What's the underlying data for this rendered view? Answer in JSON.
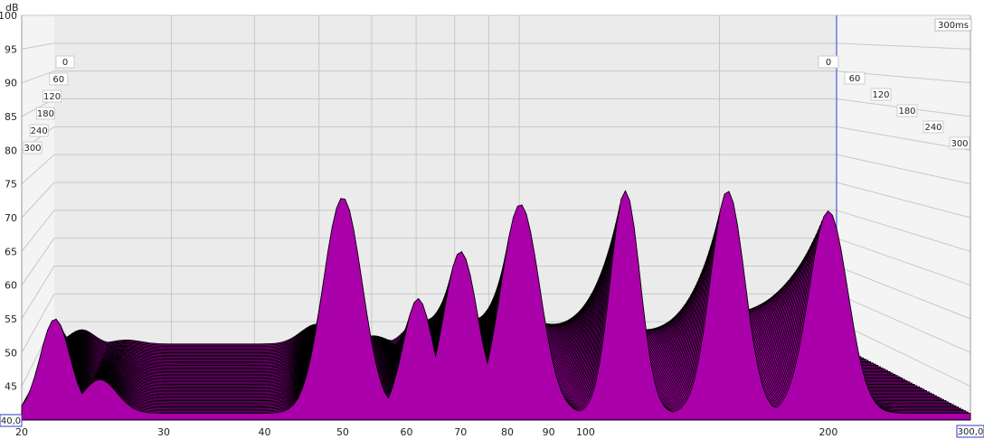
{
  "chart_data": {
    "type": "waterfall",
    "y_unit": "dB",
    "ylim": [
      40,
      100
    ],
    "y_ticks": [
      45,
      50,
      55,
      60,
      65,
      70,
      75,
      80,
      85,
      90,
      95,
      100
    ],
    "xlim": [
      20,
      300
    ],
    "x_scale": "log",
    "x_ticks": [
      20,
      30,
      40,
      50,
      60,
      70,
      80,
      90,
      100,
      200
    ],
    "x_min_label": "20",
    "x_max_label": "300,0",
    "y_min_label": "40,0",
    "z_ticks": [
      "0",
      "60",
      "120",
      "180",
      "240",
      "300"
    ],
    "z_max_label": "300ms",
    "z_range_ms": [
      0,
      300
    ],
    "fill_color": "#aa00aa",
    "grid": true,
    "peaks": [
      {
        "hz": 22,
        "db": 58
      },
      {
        "hz": 25,
        "db": 49
      },
      {
        "hz": 50,
        "db": 76
      },
      {
        "hz": 62,
        "db": 61
      },
      {
        "hz": 70,
        "db": 68
      },
      {
        "hz": 83,
        "db": 75
      },
      {
        "hz": 112,
        "db": 77
      },
      {
        "hz": 150,
        "db": 77
      },
      {
        "hz": 200,
        "db": 74
      }
    ]
  }
}
